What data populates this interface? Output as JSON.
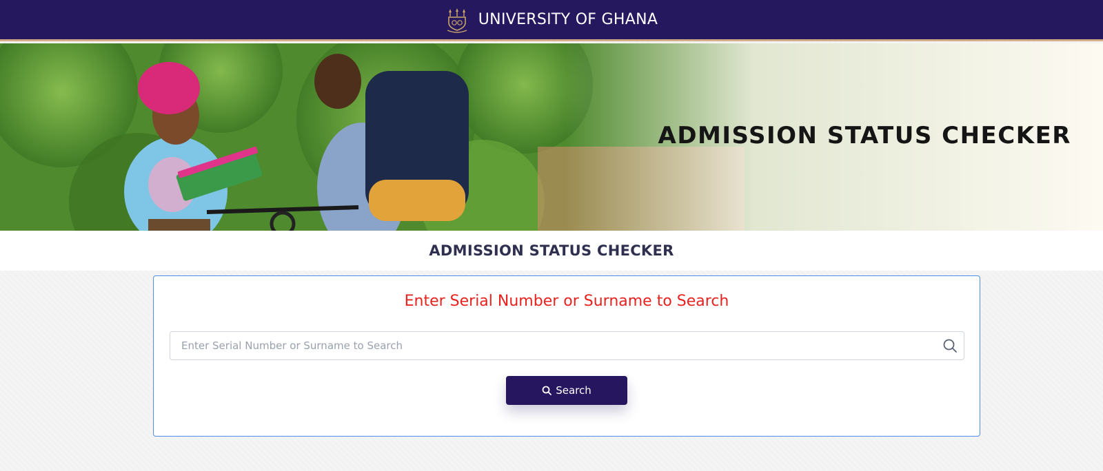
{
  "header": {
    "brand_name": "UNIVERSITY OF GHANA",
    "logo_icon": "university-crest-icon",
    "background": "#26185e",
    "accent": "#d3ad88"
  },
  "hero": {
    "title": "ADMISSION STATUS CHECKER"
  },
  "page": {
    "title": "ADMISSION STATUS CHECKER"
  },
  "search_card": {
    "heading": "Enter Serial Number or Surname to Search",
    "heading_color": "#e8221e",
    "input": {
      "value": "",
      "placeholder": "Enter Serial Number or Surname to Search",
      "icon": "search-icon"
    },
    "button": {
      "label": "Search",
      "icon": "search-icon",
      "color": "#26155f"
    }
  }
}
